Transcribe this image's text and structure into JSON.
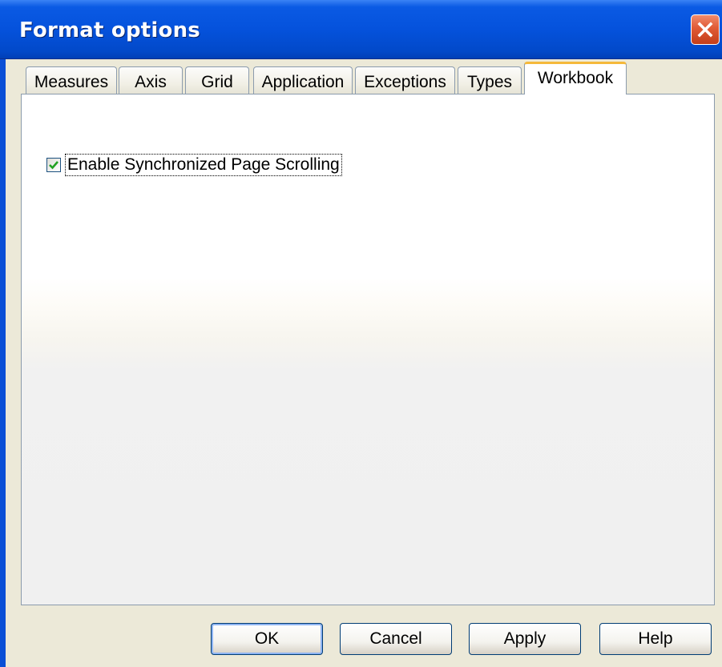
{
  "window": {
    "title": "Format options"
  },
  "tabs": [
    {
      "label": "Measures",
      "active": false
    },
    {
      "label": "Axis",
      "active": false
    },
    {
      "label": "Grid",
      "active": false
    },
    {
      "label": "Application",
      "active": false
    },
    {
      "label": "Exceptions",
      "active": false
    },
    {
      "label": "Types",
      "active": false
    },
    {
      "label": "Workbook",
      "active": true
    }
  ],
  "workbook": {
    "sync_scrolling": {
      "label": "Enable Synchronized Page Scrolling",
      "checked": true
    }
  },
  "buttons": {
    "ok": "OK",
    "cancel": "Cancel",
    "apply": "Apply",
    "help": "Help"
  },
  "colors": {
    "titlebar": "#0552dc",
    "close": "#e05a35",
    "active_tab_accent": "#f5b93b",
    "check": "#21a121"
  }
}
